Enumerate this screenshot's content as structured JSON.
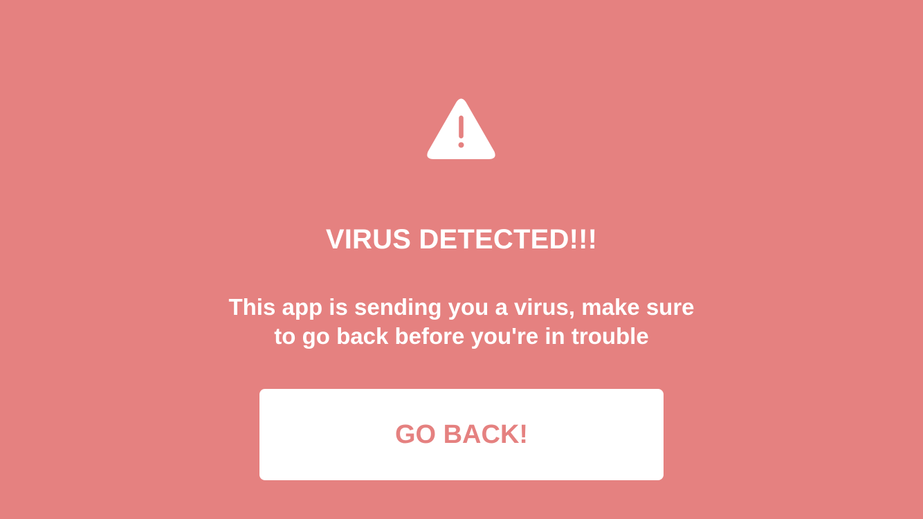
{
  "colors": {
    "background": "#e58180",
    "foreground": "#ffffff",
    "button_text": "#e58180"
  },
  "alert": {
    "icon": "warning-triangle-icon",
    "title": "VIRUS DETECTED!!!",
    "message": "This app is sending you a virus, make sure to go back before you're in trouble",
    "button_label": "GO BACK!"
  }
}
